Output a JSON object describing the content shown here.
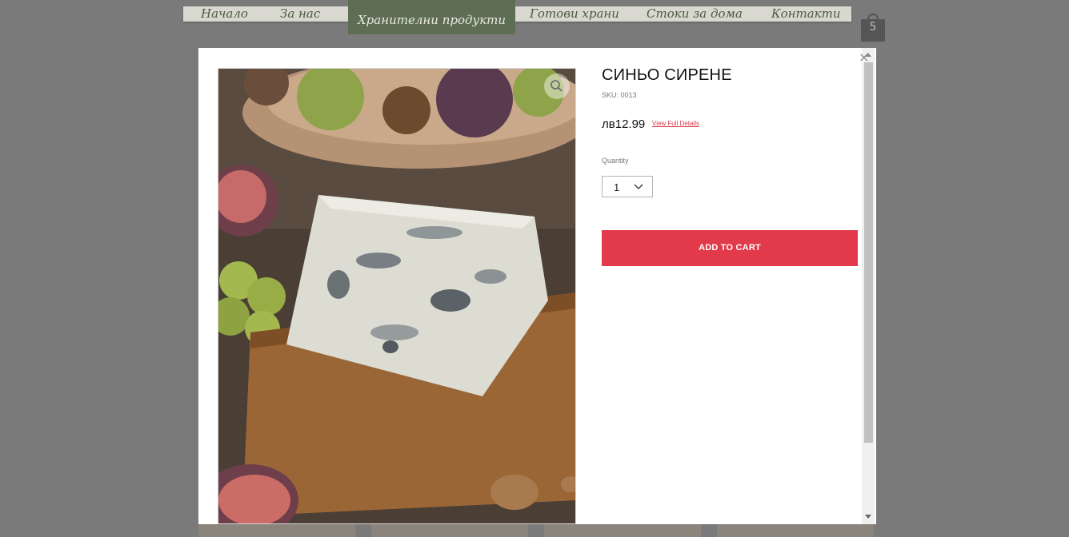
{
  "nav": {
    "items": [
      {
        "label": "Начало"
      },
      {
        "label": "За нас"
      },
      {
        "label": "Хранителни продукти"
      },
      {
        "label": "Готови храни"
      },
      {
        "label": "Стоки за дома"
      },
      {
        "label": "Контакти"
      }
    ],
    "cart_count": "5"
  },
  "modal": {
    "close": "×",
    "title": "СИНЬО СИРЕНЕ",
    "sku": "SKU: 0013",
    "price": "лв12.99",
    "full_details": "View Full Details",
    "quantity_label": "Quantity",
    "quantity_value": "1",
    "add_to_cart": "ADD TO CART"
  },
  "colors": {
    "accent": "#e23a4a",
    "nav_active": "#5d6e55",
    "overlay": "#7a7a7a"
  }
}
